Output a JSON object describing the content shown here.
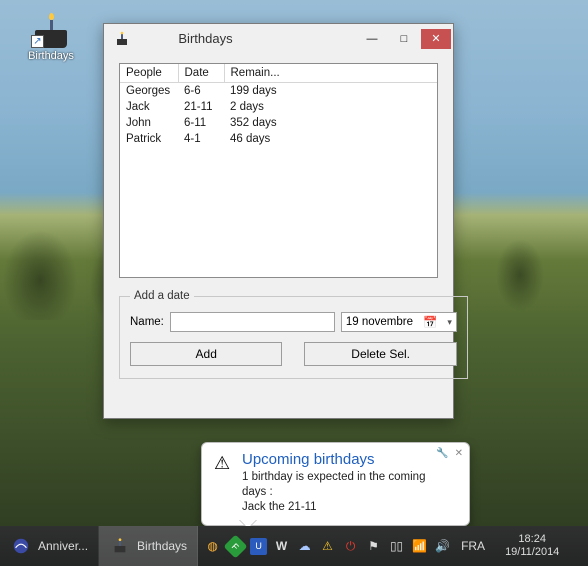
{
  "desktop": {
    "icon_label": "Birthdays"
  },
  "window": {
    "title": "Birthdays",
    "columns": {
      "c0": "People",
      "c1": "Date",
      "c2": "Remain..."
    },
    "rows": [
      {
        "people": "Georges",
        "date": "6-6",
        "remain": "199 days"
      },
      {
        "people": "Jack",
        "date": "21-11",
        "remain": "2 days"
      },
      {
        "people": "John",
        "date": "6-11",
        "remain": "352 days"
      },
      {
        "people": "Patrick",
        "date": "4-1",
        "remain": "46 days"
      }
    ],
    "legend": "Add a date",
    "name_label": "Name:",
    "name_value": "",
    "date_value": "19 novembre",
    "add_button": "Add",
    "delete_button": "Delete Sel."
  },
  "balloon": {
    "title": "Upcoming birthdays",
    "line1": "1 birthday is expected in the coming days :",
    "line2": "Jack the 21-11"
  },
  "taskbar": {
    "items": [
      {
        "label": "Anniver..."
      },
      {
        "label": "Birthdays"
      }
    ],
    "lang": "FRA",
    "clock": {
      "time": "18:24",
      "date": "19/11/2014"
    }
  },
  "icons": {
    "min": "—",
    "max": "□",
    "close": "✕",
    "cal": "📅",
    "chev": "▾",
    "warn": "⚠",
    "wrench": "🔧",
    "flag": "⚑",
    "battery": "▯▯",
    "wifi": "📶",
    "vol": "🔊"
  }
}
